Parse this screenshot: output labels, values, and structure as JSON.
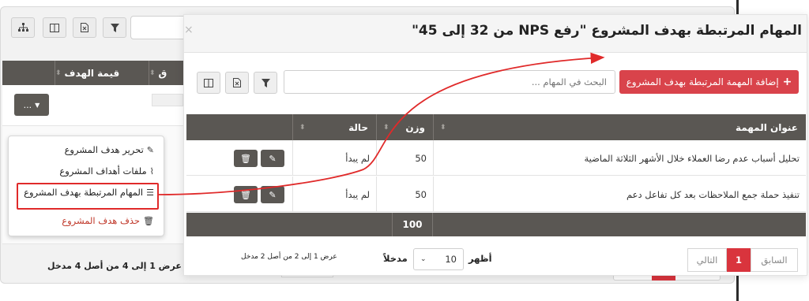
{
  "background": {
    "columns": {
      "goal_value": "قيمة الهدف",
      "truncated": "ق"
    },
    "row_action_label": "...",
    "showing_text": "عرض 1 إلى 4 من أصل 4 مدخل"
  },
  "context_menu": {
    "items": [
      {
        "label": "تحرير هدف المشروع",
        "icon": "edit-icon"
      },
      {
        "label": "ملفات أهداف المشروع",
        "icon": "paperclip-icon"
      },
      {
        "label": "المهام المرتبطة بهدف المشروع",
        "icon": "list-icon"
      },
      {
        "label": "حذف هدف المشروع",
        "icon": "trash-icon"
      }
    ]
  },
  "modal": {
    "title": "المهام المرتبطة بهدف المشروع \"رفع NPS من 32 إلى 45\"",
    "close_label": "×",
    "add_button_label": "إضافة المهمة المرتبطة بهدف المشروع",
    "search_placeholder": "البحث في المهام ...",
    "columns": {
      "title": "عنوان المهمة",
      "weight": "وزن",
      "status": "حالة"
    },
    "rows": [
      {
        "title": "تحليل أسباب عدم رضا العملاء خلال الأشهر الثلاثة الماضية",
        "weight": "50",
        "status": "لم يبدأ"
      },
      {
        "title": "تنفيذ حملة جمع الملاحظات بعد كل تفاعل دعم",
        "weight": "50",
        "status": "لم يبدأ"
      }
    ],
    "total_weight": "100",
    "pagination": {
      "previous": "السابق",
      "current": "1",
      "next": "التالي"
    },
    "length": {
      "show_label": "أظهر",
      "value": "10",
      "entries_label": "مدخلاً"
    },
    "info_text": "عرض 1 إلى 2 من أصل 2 مدخل"
  },
  "colors": {
    "accent_red": "#d9434b",
    "header_dark": "#5a5753",
    "annotation_red": "#e02a2a"
  }
}
